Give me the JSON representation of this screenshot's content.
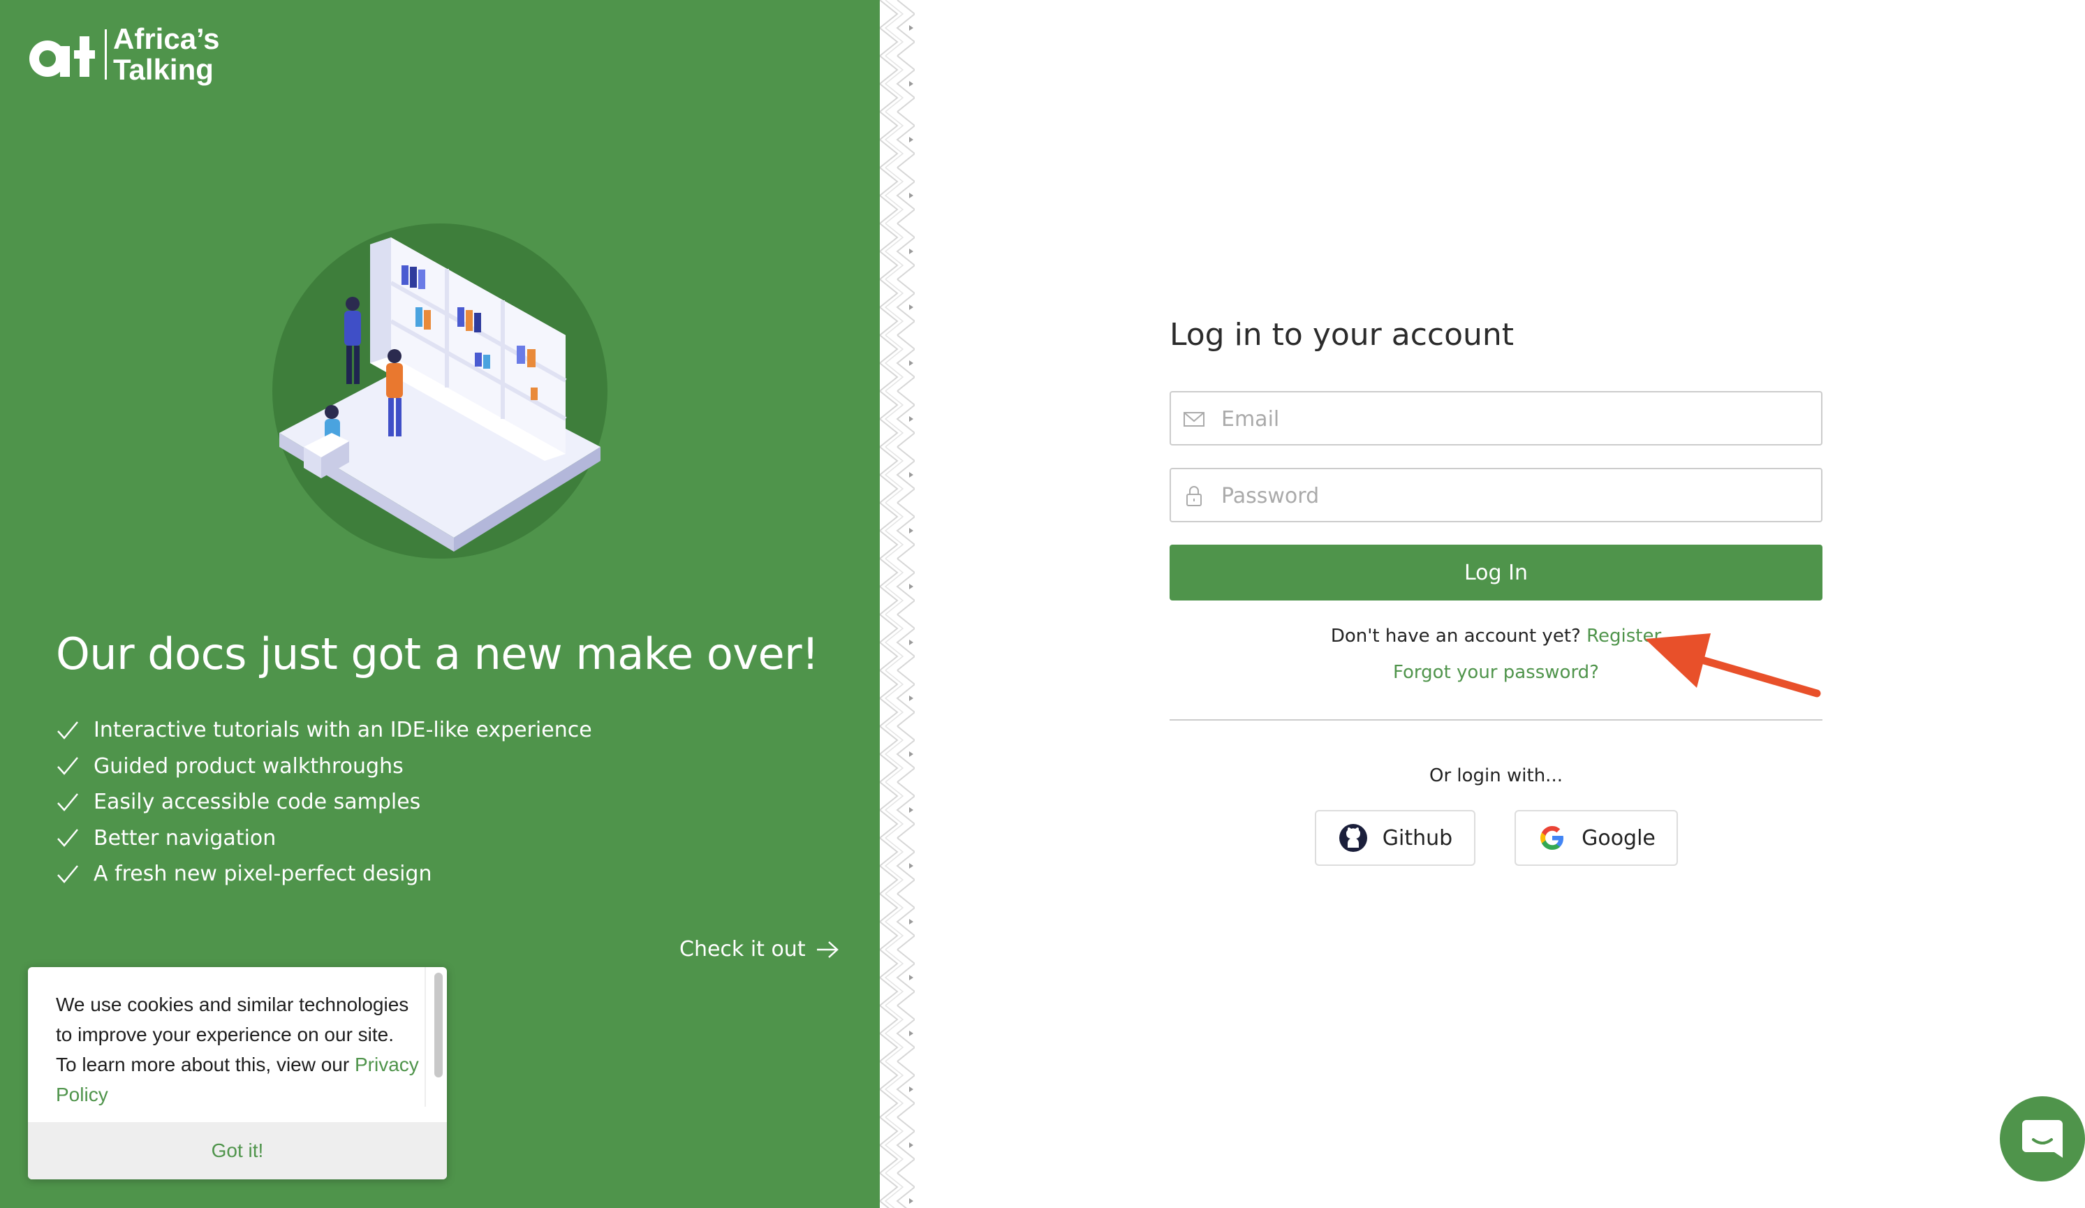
{
  "brand": {
    "name_line1": "Africa’s",
    "name_line2": "Talking",
    "mark": "at",
    "color": "#4f944b"
  },
  "promo": {
    "title": "Our docs just got a new make over!",
    "features": [
      "Interactive tutorials with an IDE-like experience",
      "Guided product walkthroughs",
      "Easily accessible code samples",
      "Better navigation",
      "A fresh new pixel-perfect design"
    ],
    "cta_label": "Check it out"
  },
  "cookie": {
    "text": "We use cookies and similar technologies to improve your experience on our site. To learn more about this, view our ",
    "link_label": "Privacy Policy",
    "accept_label": "Got it!"
  },
  "login": {
    "title": "Log in to your account",
    "email_placeholder": "Email",
    "email_value": "",
    "password_placeholder": "Password",
    "password_value": "",
    "submit_label": "Log In",
    "no_account_text": "Don't have an account yet?",
    "register_label": "Register",
    "forgot_label": "Forgot your password?",
    "or_login_text": "Or login with...",
    "providers": [
      {
        "label": "Github",
        "icon": "github-icon"
      },
      {
        "label": "Google",
        "icon": "google-icon"
      }
    ]
  },
  "icons": {
    "email": "envelope-icon",
    "password": "lock-icon",
    "check": "checkmark-icon",
    "cta": "arrow-right-icon",
    "chat": "chat-bubble-icon",
    "annotation": "red-arrow-icon"
  },
  "colors": {
    "panel_green": "#4f944b",
    "annotation_red": "#e8502a"
  }
}
